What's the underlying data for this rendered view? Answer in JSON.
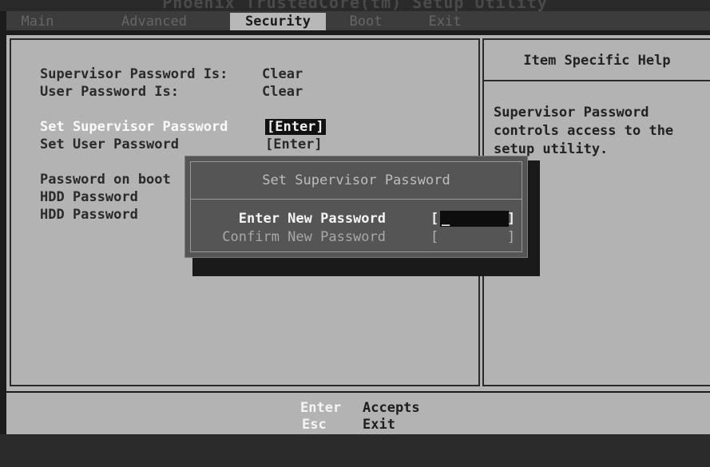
{
  "title": "Phoenix TrustedCore(tm) Setup Utility",
  "menu": {
    "tabs": [
      {
        "label": "Main"
      },
      {
        "label": "Advanced"
      },
      {
        "label": "Security"
      },
      {
        "label": "Boot"
      },
      {
        "label": "Exit"
      }
    ],
    "active": "Security"
  },
  "security": {
    "supervisor_status_label": "Supervisor Password Is:",
    "supervisor_status_value": "Clear",
    "user_status_label": "User Password Is:",
    "user_status_value": "Clear",
    "set_supervisor_label": "Set Supervisor Password",
    "set_supervisor_value": "[Enter]",
    "set_user_label": "Set User Password",
    "set_user_value": "[Enter]",
    "password_on_boot_label": "Password on boot",
    "hdd_password_1_label": "HDD Password",
    "hdd_password_2_label": "HDD Password"
  },
  "help": {
    "title": "Item Specific Help",
    "text": "Supervisor Password\ncontrols access to the\nsetup utility."
  },
  "dialog": {
    "title": "Set Supervisor Password",
    "new_password_label": "Enter New Password",
    "confirm_password_label": "Confirm New Password",
    "new_password_value": "",
    "confirm_password_value": ""
  },
  "footer": {
    "keys": [
      {
        "key": "Enter",
        "desc": "Accepts"
      },
      {
        "key": "Esc",
        "desc": "Exit"
      }
    ]
  }
}
